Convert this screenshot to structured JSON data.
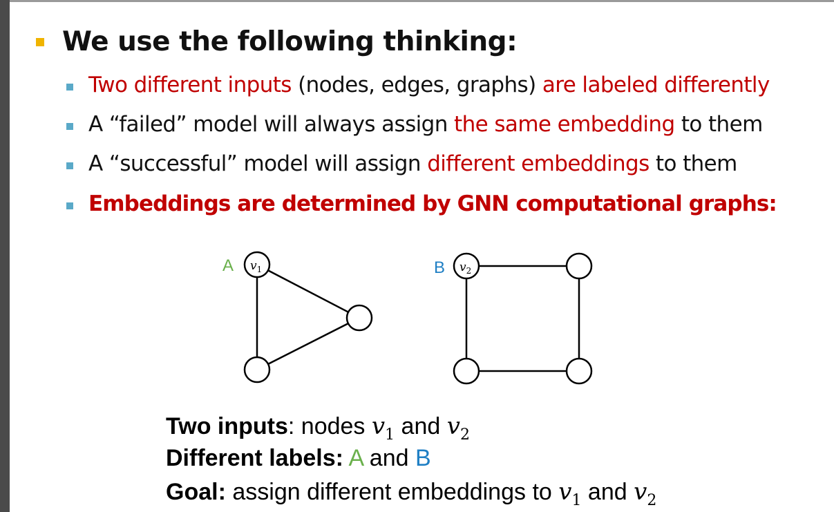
{
  "heading": "We use the following thinking:",
  "bullets": [
    {
      "parts": [
        {
          "t": "Two different inputs",
          "c": "red"
        },
        {
          "t": " (nodes, edges, graphs) ",
          "c": "black"
        },
        {
          "t": "are labeled differently",
          "c": "red"
        }
      ]
    },
    {
      "parts": [
        {
          "t": "A “failed” model will always assign ",
          "c": "black"
        },
        {
          "t": "the same embedding",
          "c": "red"
        },
        {
          "t": " to them",
          "c": "black"
        }
      ]
    },
    {
      "parts": [
        {
          "t": "A “successful” model will assign ",
          "c": "black"
        },
        {
          "t": "different embeddings",
          "c": "red"
        },
        {
          "t": " to them",
          "c": "black"
        }
      ]
    },
    {
      "parts": [
        {
          "t": "Embeddings are determined by GNN computational graphs:",
          "c": "redbold"
        }
      ]
    }
  ],
  "diagram": {
    "graph_a_label": "A",
    "graph_a_node": "v",
    "graph_a_sub": "1",
    "graph_b_label": "B",
    "graph_b_node": "v",
    "graph_b_sub": "2",
    "colors": {
      "a": "#6ab04c",
      "b": "#1f7fc4"
    }
  },
  "caption": {
    "line1_bold": "Two inputs",
    "line1_rest": ": nodes ",
    "line1_and": " and ",
    "line2_bold": "Different labels:",
    "line2_a": "A",
    "line2_and": " and ",
    "line2_b": "B",
    "line3_bold": "Goal:",
    "line3_rest": " assign different embeddings to ",
    "line3_and": " and ",
    "v": "v",
    "sub1": "1",
    "sub2": "2"
  }
}
